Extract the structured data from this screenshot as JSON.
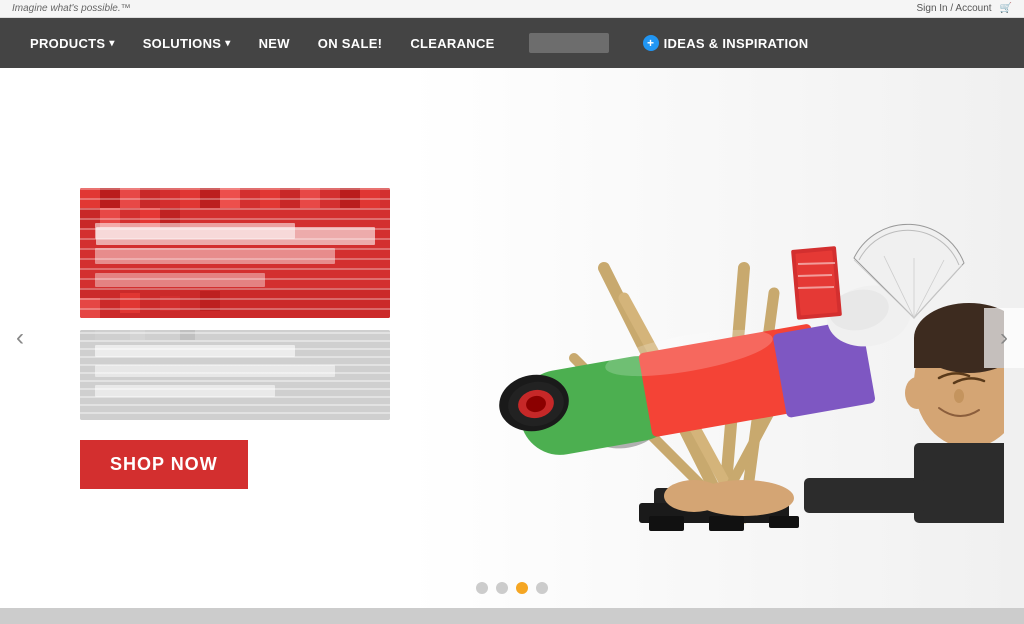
{
  "topbar": {
    "tagline": "Imagine what's possible.™",
    "sign_in": "Sign In / Account",
    "cart_icon": "cart-icon"
  },
  "nav": {
    "items": [
      {
        "id": "products",
        "label": "PRODUCTS",
        "has_dropdown": true
      },
      {
        "id": "solutions",
        "label": "SOLUTIONS",
        "has_dropdown": true
      },
      {
        "id": "new",
        "label": "NEW",
        "has_dropdown": false
      },
      {
        "id": "on-sale",
        "label": "ON SALE!",
        "has_dropdown": false
      },
      {
        "id": "clearance",
        "label": "CLEARANCE",
        "has_dropdown": false
      },
      {
        "id": "ideas",
        "label": "IDEAS & INSPIRATION",
        "has_dropdown": false,
        "has_plus": true
      }
    ]
  },
  "hero": {
    "shop_now_label": "SHOP NOW",
    "dots": [
      {
        "id": 1,
        "active": false
      },
      {
        "id": 2,
        "active": false
      },
      {
        "id": 3,
        "active": true
      },
      {
        "id": 4,
        "active": false
      }
    ],
    "arrow_left": "‹",
    "arrow_right": "›"
  }
}
